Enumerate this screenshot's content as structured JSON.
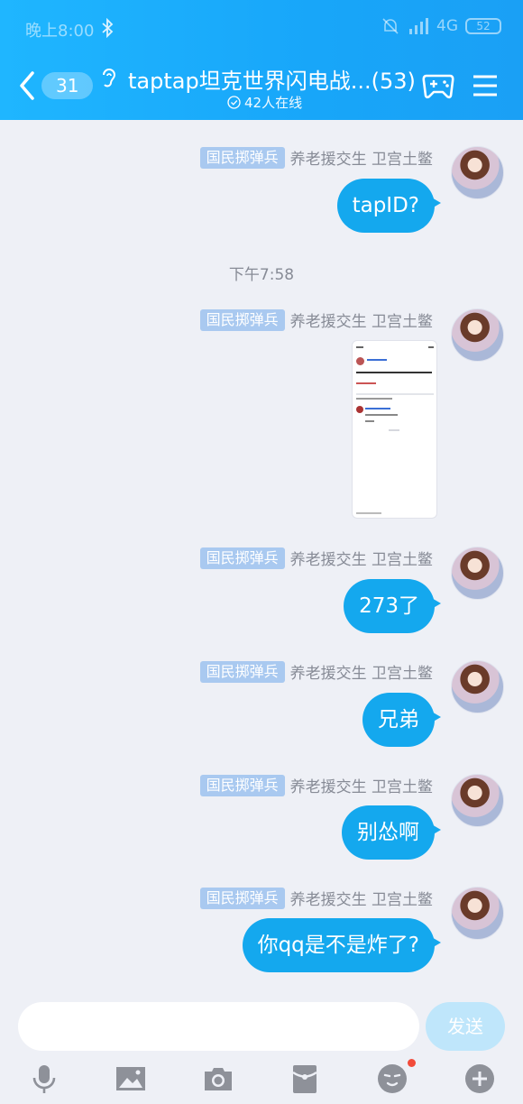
{
  "status": {
    "time": "晚上8:00",
    "network": "4G",
    "battery": "52"
  },
  "header": {
    "back_count": "31",
    "title": "taptap坦克世界闪电战...(53)",
    "online": "42人在线"
  },
  "messages": [
    {
      "tag": "国民掷弹兵",
      "nick": "养老援交生 卫宫土鳖",
      "text": "tapID?"
    },
    {
      "tag": "国民掷弹兵",
      "nick": "养老援交生 卫宫土鳖",
      "image": "screenshot"
    },
    {
      "tag": "国民掷弹兵",
      "nick": "养老援交生 卫宫土鳖",
      "text": "273了"
    },
    {
      "tag": "国民掷弹兵",
      "nick": "养老援交生 卫宫土鳖",
      "text": "兄弟"
    },
    {
      "tag": "国民掷弹兵",
      "nick": "养老援交生 卫宫土鳖",
      "text": "别怂啊"
    },
    {
      "tag": "国民掷弹兵",
      "nick": "养老援交生 卫宫土鳖",
      "text": "你qq是不是炸了?"
    }
  ],
  "time_separator": "下午7:58",
  "input": {
    "placeholder": "",
    "send_label": "发送"
  },
  "toolbar": [
    "microphone-icon",
    "image-icon",
    "camera-icon",
    "red-packet-icon",
    "emoji-icon",
    "plus-icon"
  ],
  "colors": {
    "header": "#1aa9fa",
    "bubble": "#14a8ee",
    "tag": "#a9c9f0",
    "background": "#eef0f6"
  }
}
